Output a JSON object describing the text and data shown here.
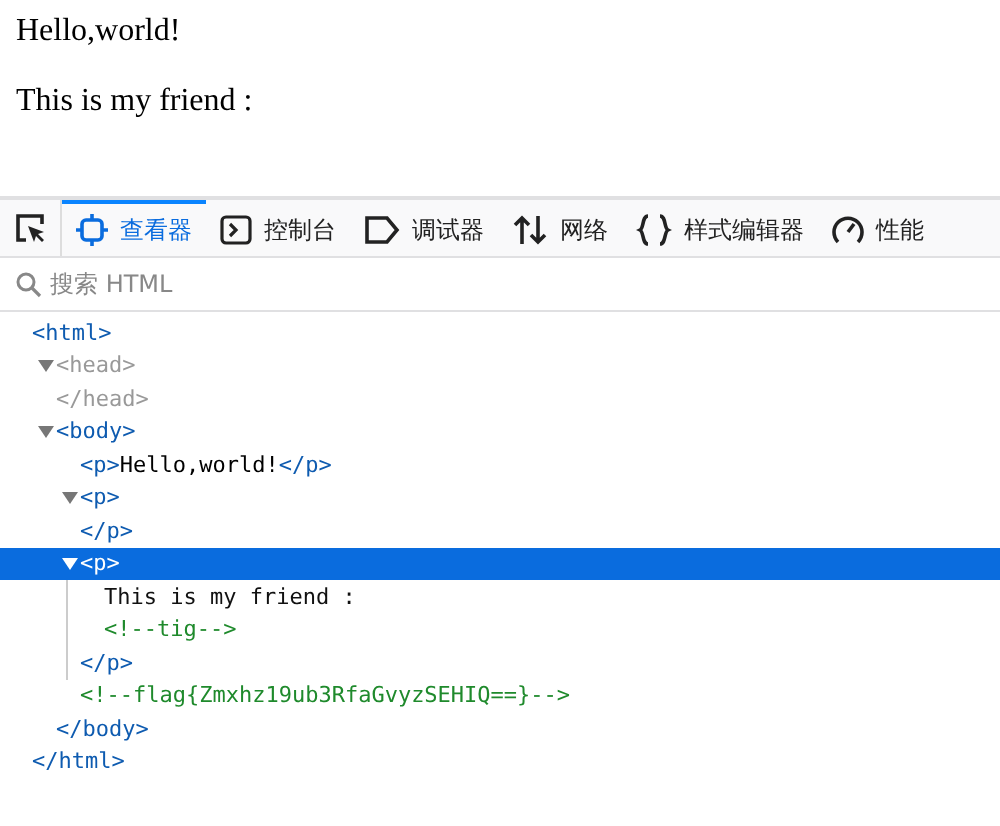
{
  "page": {
    "paragraphs": [
      "Hello,world!",
      "This is my friend :"
    ]
  },
  "toolbar": {
    "tabs": [
      {
        "label": "查看器",
        "kind": "inspector",
        "selected": true
      },
      {
        "label": "控制台",
        "kind": "console",
        "selected": false
      },
      {
        "label": "调试器",
        "kind": "debugger",
        "selected": false
      },
      {
        "label": "网络",
        "kind": "network",
        "selected": false
      },
      {
        "label": "样式编辑器",
        "kind": "style",
        "selected": false
      },
      {
        "label": "性能",
        "kind": "performance",
        "selected": false
      }
    ]
  },
  "search": {
    "placeholder": "搜索 HTML"
  },
  "tree": [
    {
      "kind": "element",
      "open": "<html>",
      "close": "</html>",
      "dimmed": false,
      "selected": false,
      "children": [
        {
          "kind": "element",
          "open": "<head>",
          "close": "</head>",
          "expanded": true,
          "dimmed": true,
          "selected": false
        },
        {
          "kind": "element",
          "open": "<body>",
          "close": "</body>",
          "expanded": true,
          "dimmed": false,
          "selected": false,
          "children": [
            {
              "kind": "inline",
              "open": "<p>",
              "text": "Hello,world!",
              "close": "</p>",
              "selected": false
            },
            {
              "kind": "element",
              "open": "<p>",
              "close": "</p>",
              "expanded": true,
              "dimmed": false,
              "selected": false
            },
            {
              "kind": "element",
              "open": "<p>",
              "close": "</p>",
              "expanded": true,
              "dimmed": false,
              "selected": true,
              "children": [
                {
                  "kind": "text",
                  "text": "This is my friend :"
                },
                {
                  "kind": "comment",
                  "text": "<!--tig-->"
                }
              ]
            },
            {
              "kind": "comment",
              "text": "<!--flag{Zmxhz19ub3RfaGvyzSEHIQ==}-->"
            }
          ]
        }
      ]
    }
  ]
}
